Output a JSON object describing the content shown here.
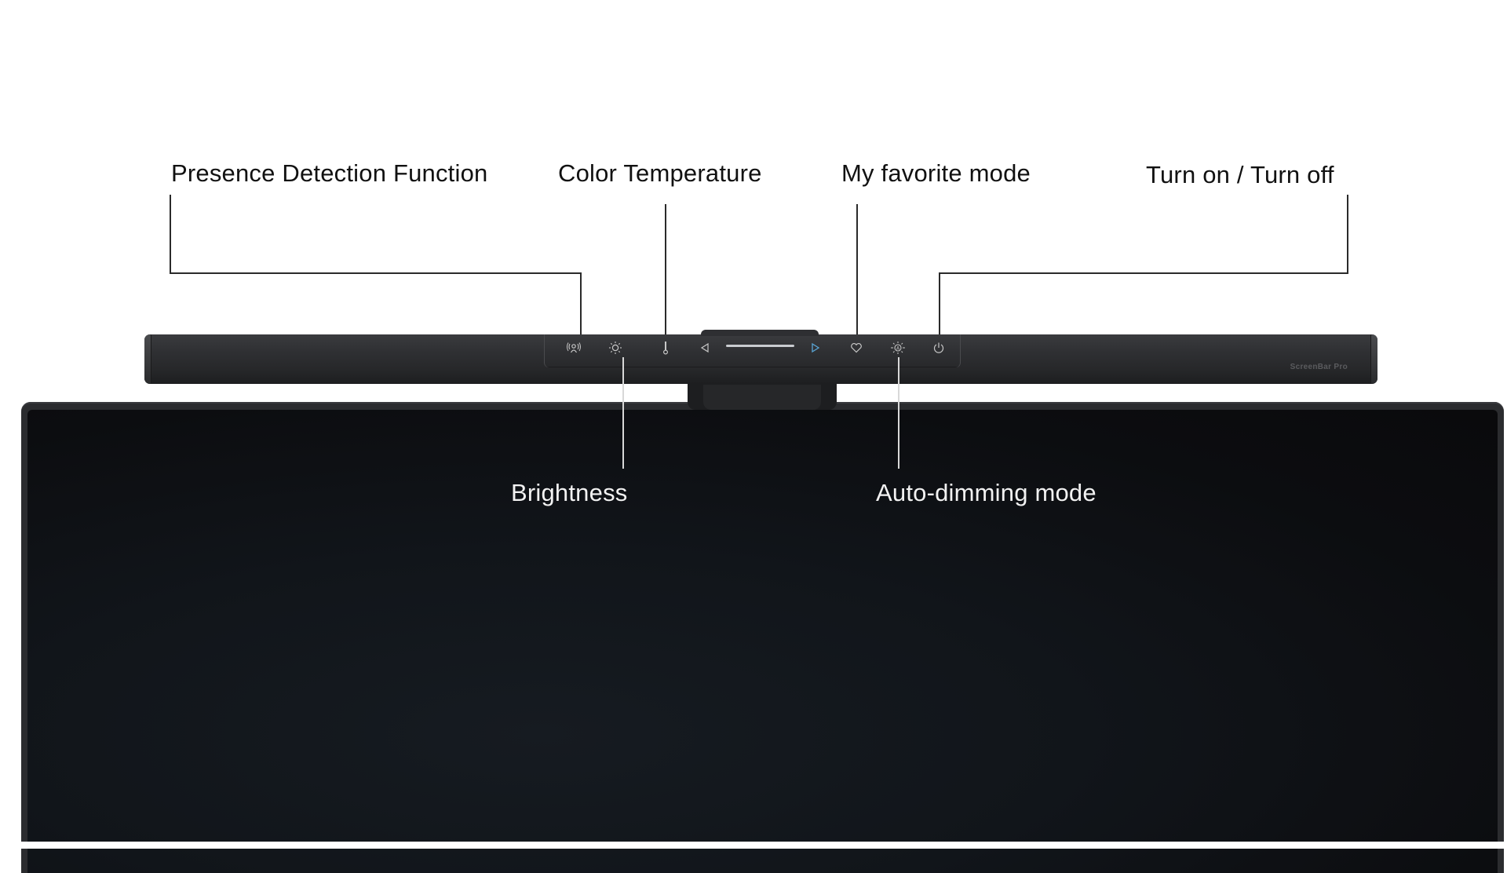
{
  "product": {
    "brand_text": "ScreenBar Pro",
    "colors": {
      "background": "#ffffff",
      "bar": "#2f3033",
      "icon": "#c8c8c8",
      "active_arrow": "#5aa6d6",
      "screen": "#101419",
      "label_dark": "#111111",
      "label_light": "#f2f2f2"
    }
  },
  "labels_top": [
    {
      "text": "Presence Detection Function",
      "icon": "presence-detection-icon"
    },
    {
      "text": "Color Temperature",
      "icon": "thermometer-icon"
    },
    {
      "text": "My favorite mode",
      "icon": "heart-icon"
    },
    {
      "text": "Turn on / Turn off",
      "icon": "power-icon"
    }
  ],
  "labels_bottom": [
    {
      "text": "Brightness",
      "icon": "sun-icon"
    },
    {
      "text": "Auto-dimming mode",
      "icon": "auto-dim-icon"
    }
  ],
  "controls": [
    {
      "name": "presence-detection",
      "icon": "presence-detection-icon"
    },
    {
      "name": "brightness",
      "icon": "sun-icon"
    },
    {
      "name": "color-temperature",
      "icon": "thermometer-icon"
    },
    {
      "name": "decrease",
      "icon": "triangle-left-icon"
    },
    {
      "name": "level-slider",
      "icon": "slider-track"
    },
    {
      "name": "increase",
      "icon": "triangle-right-icon"
    },
    {
      "name": "favorite-mode",
      "icon": "heart-icon"
    },
    {
      "name": "auto-dimming",
      "icon": "auto-dim-icon"
    },
    {
      "name": "power",
      "icon": "power-icon"
    }
  ]
}
